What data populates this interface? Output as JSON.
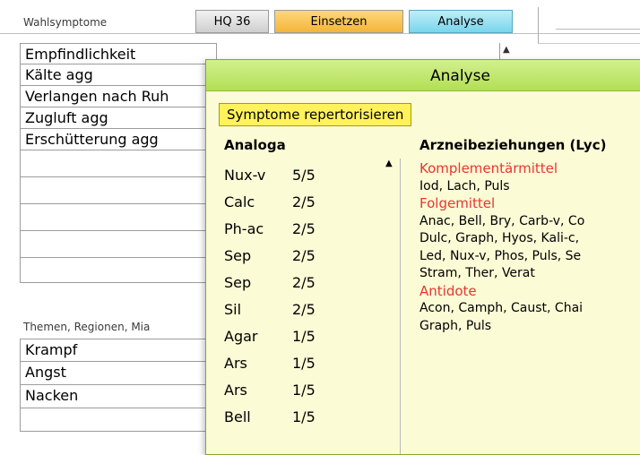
{
  "toolbar": {
    "label": "Wahlsymptome",
    "tabs": [
      {
        "label": "HQ 36"
      },
      {
        "label": "Einsetzen"
      },
      {
        "label": "Analyse"
      }
    ]
  },
  "symptoms": [
    "Empfindlichkeit",
    "Kälte agg",
    "Verlangen nach Ruh",
    "Zugluft agg",
    "Erschütterung agg",
    "",
    "",
    "",
    "",
    ""
  ],
  "themes": {
    "label": "Themen, Regionen, Mia",
    "items": [
      "Krampf",
      "Angst",
      "Nacken",
      ""
    ]
  },
  "popup": {
    "title": "Analyse",
    "repertorize_button": "Symptome repertorisieren",
    "analoga_header": "Analoga",
    "analoga": [
      {
        "name": "Nux-v",
        "score": "5/5"
      },
      {
        "name": "Calc",
        "score": "2/5"
      },
      {
        "name": "Ph-ac",
        "score": "2/5"
      },
      {
        "name": "Sep",
        "score": "2/5"
      },
      {
        "name": "Sep",
        "score": "2/5"
      },
      {
        "name": "Sil",
        "score": "2/5"
      },
      {
        "name": "Agar",
        "score": "1/5"
      },
      {
        "name": "Ars",
        "score": "1/5"
      },
      {
        "name": "Ars",
        "score": "1/5"
      },
      {
        "name": "Bell",
        "score": "1/5"
      }
    ],
    "relations_header": "Arzneibeziehungen (Lyc)",
    "relations": {
      "komplementaer_heading": "Komplementärmittel",
      "komplementaer_lines": [
        "Iod, Lach, Puls"
      ],
      "folge_heading": "Folgemittel",
      "folge_lines": [
        "Anac, Bell, Bry, Carb-v, Co",
        "Dulc, Graph, Hyos, Kali-c,",
        "Led, Nux-v, Phos, Puls, Se",
        "Stram, Ther, Verat"
      ],
      "antidote_heading": "Antidote",
      "antidote_lines": [
        "Acon, Camph, Caust, Chai",
        "Graph, Puls"
      ]
    }
  },
  "colors": {
    "accent_red": "#e8362f",
    "popup_bg": "#fbfbd6",
    "header_green": "#b3df55",
    "button_yellow": "#fff25a"
  }
}
